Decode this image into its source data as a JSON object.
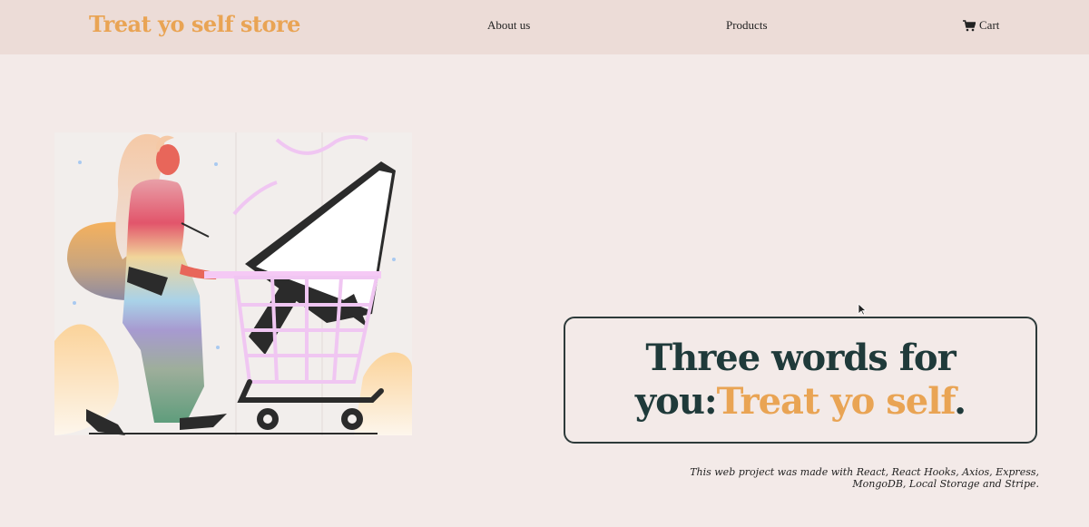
{
  "brand": {
    "name": "Treat yo self store"
  },
  "nav": {
    "about_label": "About us",
    "products_label": "Products",
    "cart_label": "Cart",
    "cart_icon": "shopping-cart-icon"
  },
  "hero": {
    "illustration_icon": "woman-pushing-shopping-cart-illustration",
    "headline_prefix": "Three words for you:",
    "headline_accent": "Treat yo self",
    "headline_suffix": "."
  },
  "footer": {
    "note_line1": "This web project was made with React, React Hooks, Axios, Express,",
    "note_line2": "MongoDB, Local Storage and Stripe."
  },
  "colors": {
    "background": "#f3eae8",
    "navbar": "#ecdcd7",
    "accent": "#e9a454",
    "heading": "#1f3a3a"
  }
}
